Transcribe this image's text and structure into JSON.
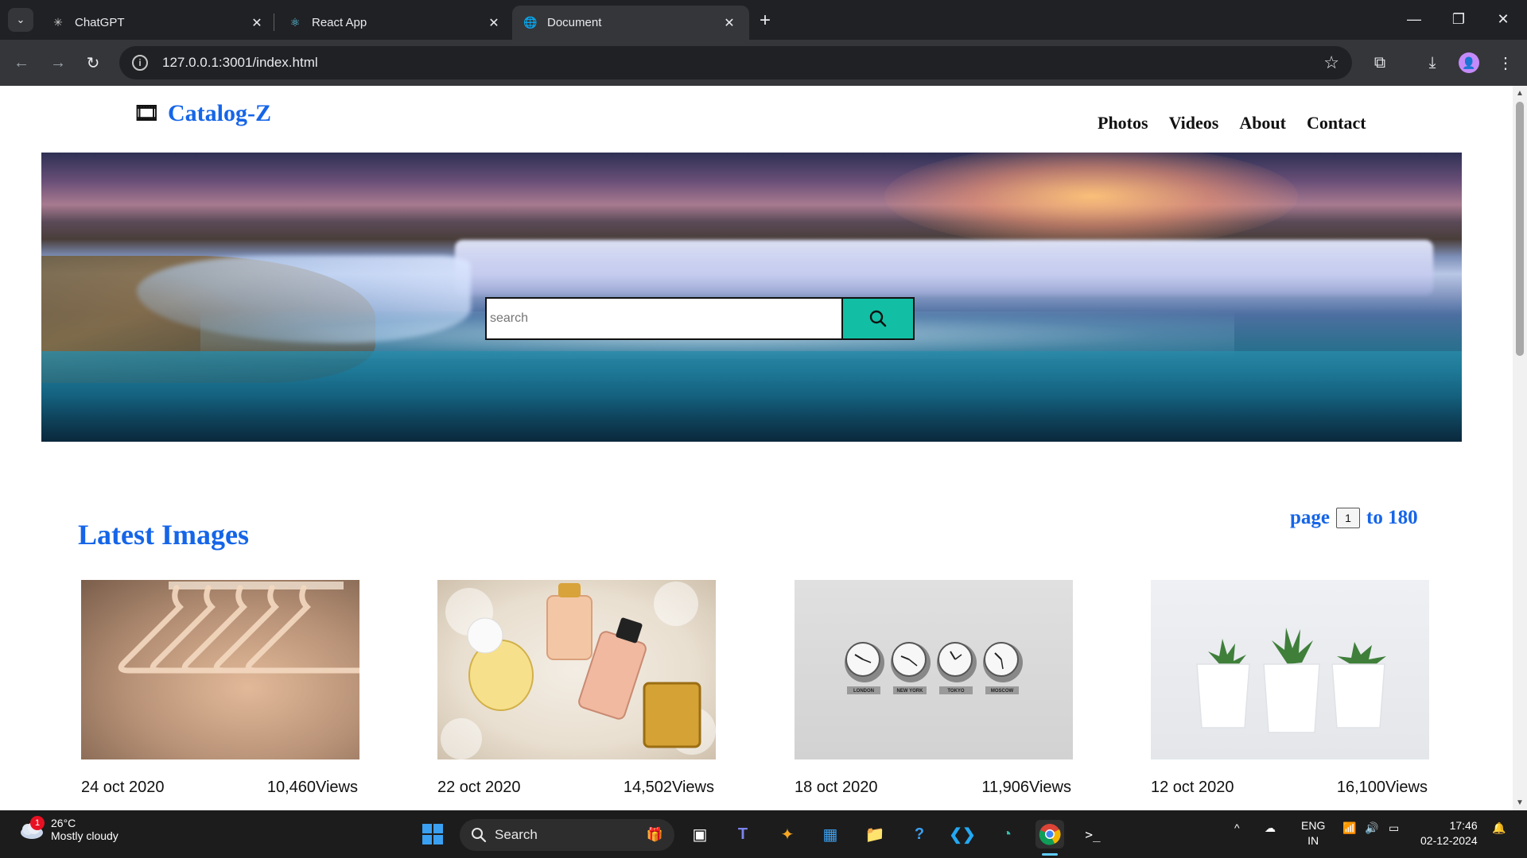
{
  "browser": {
    "tabs": [
      {
        "title": "ChatGPT",
        "icon": "chatgpt-icon"
      },
      {
        "title": "React App",
        "icon": "react-icon"
      },
      {
        "title": "Document",
        "icon": "globe-icon",
        "active": true
      }
    ],
    "url": "127.0.0.1:3001/index.html"
  },
  "site": {
    "brand": "Catalog-Z",
    "nav": [
      "Photos",
      "Videos",
      "About",
      "Contact"
    ],
    "search_placeholder": "search",
    "section_title": "Latest Images",
    "pager": {
      "prefix": "page",
      "current": "1",
      "suffix": "to 180"
    },
    "cards": [
      {
        "date": "24 oct 2020",
        "views": "10,460Views",
        "subject": "hangers"
      },
      {
        "date": "22 oct 2020",
        "views": "14,502Views",
        "subject": "perfume"
      },
      {
        "date": "18 oct 2020",
        "views": "11,906Views",
        "subject": "clocks"
      },
      {
        "date": "12 oct 2020",
        "views": "16,100Views",
        "subject": "plants"
      }
    ],
    "clock_labels": [
      "LONDON",
      "NEW YORK",
      "TOKYO",
      "MOSCOW"
    ]
  },
  "taskbar": {
    "weather": {
      "temp": "26°C",
      "condition": "Mostly cloudy",
      "badge": "1"
    },
    "search_label": "Search",
    "lang": {
      "line1": "ENG",
      "line2": "IN"
    },
    "time": "17:46",
    "date": "02-12-2024"
  },
  "colors": {
    "accent": "#1565e8",
    "search_button": "#12bfa4"
  }
}
